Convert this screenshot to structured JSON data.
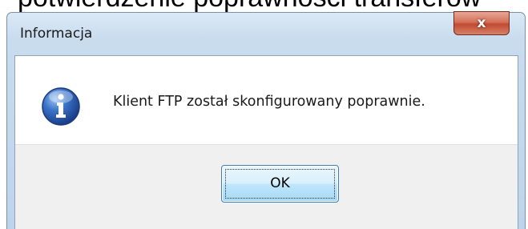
{
  "background": {
    "heading_fragment": "potwierdzenie poprawności transferów"
  },
  "dialog": {
    "title": "Informacja",
    "close_label": "x",
    "message": "Klient FTP został skonfigurowany poprawnie.",
    "icon": "information-icon",
    "ok_label": "OK"
  },
  "colors": {
    "frame": "#bed4ea",
    "close_button": "#c14a31",
    "ok_button": "#bee6fd",
    "info_icon": "#2a5bb0"
  }
}
